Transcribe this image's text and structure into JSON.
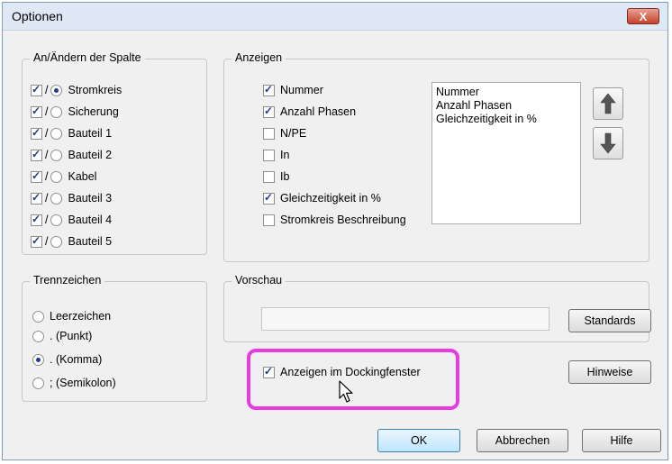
{
  "window": {
    "title": "Optionen",
    "close_label": "X"
  },
  "columns_group": {
    "legend": "An/Ändern der Spalte",
    "separator": "/",
    "items": [
      {
        "label": "Stromkreis",
        "checked": true,
        "selected": true
      },
      {
        "label": "Sicherung",
        "checked": true,
        "selected": false
      },
      {
        "label": "Bauteil 1",
        "checked": true,
        "selected": false
      },
      {
        "label": "Bauteil 2",
        "checked": true,
        "selected": false
      },
      {
        "label": "Kabel",
        "checked": true,
        "selected": false
      },
      {
        "label": "Bauteil 3",
        "checked": true,
        "selected": false
      },
      {
        "label": "Bauteil 4",
        "checked": true,
        "selected": false
      },
      {
        "label": "Bauteil 5",
        "checked": true,
        "selected": false
      }
    ]
  },
  "display_group": {
    "legend": "Anzeigen",
    "items": [
      {
        "label": "Nummer",
        "checked": true
      },
      {
        "label": "Anzahl Phasen",
        "checked": true
      },
      {
        "label": "N/PE",
        "checked": false
      },
      {
        "label": "In",
        "checked": false
      },
      {
        "label": "Ib",
        "checked": false
      },
      {
        "label": "Gleichzeitigkeit in %",
        "checked": true
      },
      {
        "label": "Stromkreis Beschreibung",
        "checked": false
      }
    ],
    "order_list": [
      "Nummer",
      "Anzahl Phasen",
      "Gleichzeitigkeit in %"
    ]
  },
  "separator_group": {
    "legend": "Trennzeichen",
    "options": [
      {
        "label": "Leerzeichen",
        "selected": false
      },
      {
        "label": ". (Punkt)",
        "selected": false
      },
      {
        "label": ". (Komma)",
        "selected": true
      },
      {
        "label": "; (Semikolon)",
        "selected": false
      }
    ]
  },
  "preview_group": {
    "legend": "Vorschau",
    "value": ""
  },
  "docking": {
    "label": "Anzeigen im Dockingfenster",
    "checked": true
  },
  "buttons": {
    "standards": "Standards",
    "hints": "Hinweise",
    "ok": "OK",
    "cancel": "Abbrechen",
    "help": "Hilfe"
  },
  "colors": {
    "highlight": "#e83be0",
    "check": "#1c3c8c"
  }
}
